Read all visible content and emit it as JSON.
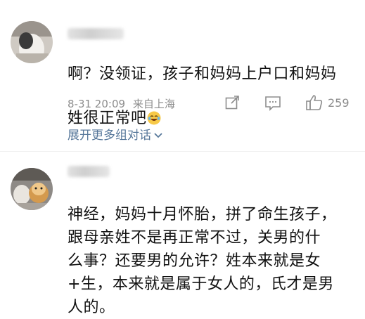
{
  "comments": [
    {
      "text": "啊？没领证，孩子和妈妈上户口和妈妈\n姓很正常吧",
      "emoji": "laughing-tears-emoji",
      "time": "8-31 20:09",
      "source": "来自上海",
      "likes": "259",
      "expand_label": "展开更多组对话"
    },
    {
      "text": "神经，妈妈十月怀胎，拼了命生孩子，\n跟母亲姓不是再正常不过，关男的什\n么事？还要男的允许？姓本来就是女\n+生，本来就是属于女人的，氏才是男\n人的。"
    }
  ],
  "colors": {
    "link": "#56779a",
    "meta": "#8d8d8d",
    "text": "#111111"
  }
}
